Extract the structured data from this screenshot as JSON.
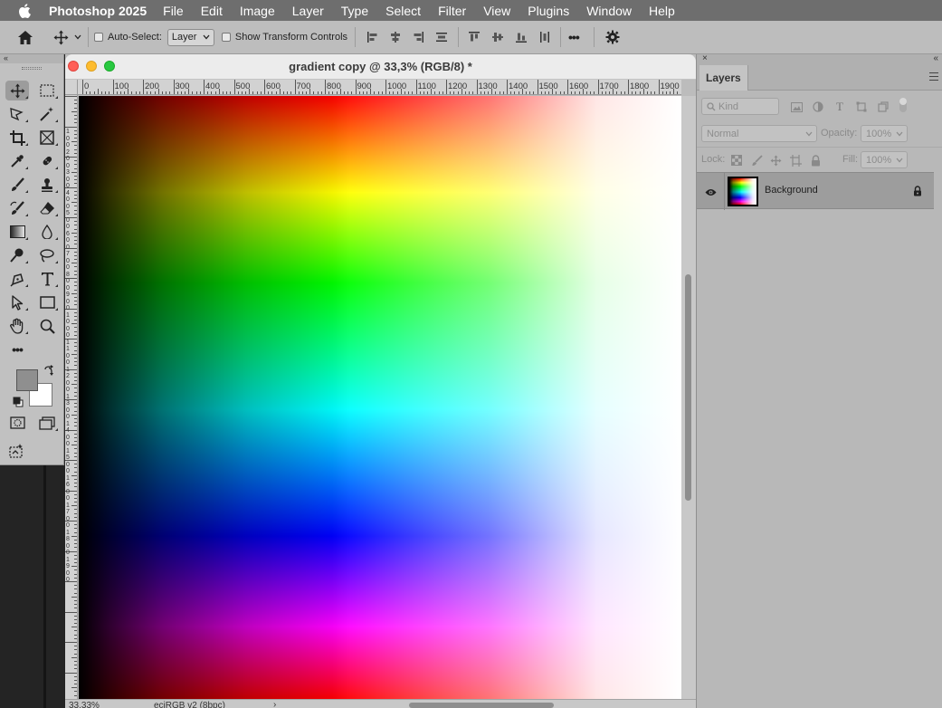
{
  "menubar": {
    "app_name": "Photoshop 2025",
    "items": [
      "File",
      "Edit",
      "Image",
      "Layer",
      "Type",
      "Select",
      "Filter",
      "View",
      "Plugins",
      "Window",
      "Help"
    ]
  },
  "options_bar": {
    "auto_select_label": "Auto-Select:",
    "auto_select_checked": false,
    "auto_select_target": "Layer",
    "show_transform_label": "Show Transform Controls",
    "show_transform_checked": false,
    "more_label": "•••"
  },
  "tools": {
    "collapse_label": "«",
    "active_tool": "move-tool",
    "more_label": "•••",
    "foreground_color": "#8f8f8f",
    "background_color": "#ffffff"
  },
  "document": {
    "title": "gradient copy @ 33,3% (RGB/8) *",
    "ruler_labels": [
      "0",
      "100",
      "200",
      "300",
      "400",
      "500",
      "600",
      "700",
      "800",
      "900",
      "1000",
      "1100",
      "1200",
      "1300",
      "1400",
      "1500",
      "1600",
      "1700",
      "1800",
      "1900"
    ],
    "vruler_labels": [
      "1",
      "0",
      "0",
      "2",
      "0",
      "0",
      "3",
      "0",
      "0",
      "4",
      "0",
      "0",
      "5",
      "0",
      "0",
      "6",
      "0",
      "0",
      "7",
      "0",
      "0",
      "8",
      "0",
      "0",
      "9",
      "0",
      "0",
      "1",
      "0",
      "0",
      "0",
      "1",
      "1",
      "0",
      "0",
      "1",
      "2",
      "0",
      "0",
      "1",
      "3",
      "0",
      "0",
      "1",
      "4",
      "0",
      "0",
      "1",
      "5",
      "0",
      "0",
      "1",
      "6",
      "0",
      "0",
      "1",
      "7",
      "0",
      "0",
      "1",
      "8",
      "0",
      "0",
      "1",
      "9",
      "0",
      "0"
    ],
    "status_zoom": "33,33%",
    "status_profile": "eciRGB v2 (8bpc)",
    "status_arrow": "›"
  },
  "layers_panel": {
    "collapse_label": "«",
    "close_label": "×",
    "tab_label": "Layers",
    "filter_kind": "Kind",
    "blend_mode": "Normal",
    "opacity_label": "Opacity:",
    "opacity_value": "100%",
    "lock_label": "Lock:",
    "fill_label": "Fill:",
    "fill_value": "100%",
    "layers": [
      {
        "name": "Background",
        "visible": true,
        "locked": true
      }
    ]
  }
}
